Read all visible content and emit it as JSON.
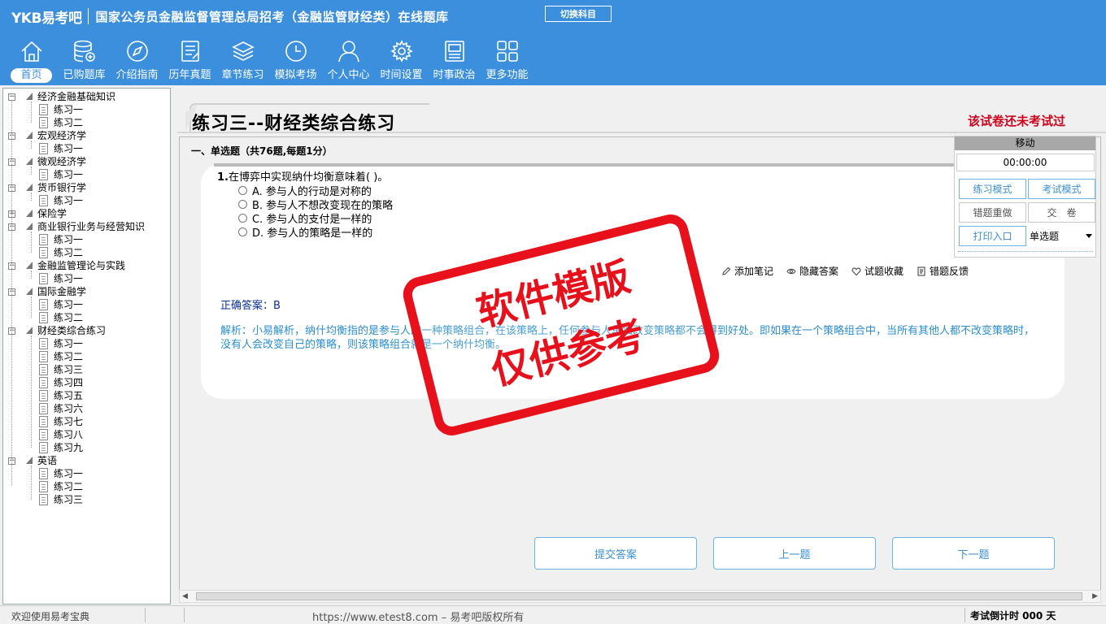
{
  "header": {
    "logo": "YKB易考吧",
    "app_title": "国家公务员金融监督管理总局招考（金融监管财经类）在线题库",
    "switch_subject": "切换科目"
  },
  "nav": [
    {
      "label": "首页",
      "icon": "home-icon"
    },
    {
      "label": "已购题库",
      "icon": "database-icon"
    },
    {
      "label": "介绍指南",
      "icon": "compass-icon"
    },
    {
      "label": "历年真题",
      "icon": "document-icon"
    },
    {
      "label": "章节练习",
      "icon": "layers-icon"
    },
    {
      "label": "模拟考场",
      "icon": "clock-icon"
    },
    {
      "label": "个人中心",
      "icon": "user-icon"
    },
    {
      "label": "时间设置",
      "icon": "gear-icon"
    },
    {
      "label": "时事政治",
      "icon": "news-icon"
    },
    {
      "label": "更多功能",
      "icon": "grid-icon"
    }
  ],
  "tree": [
    {
      "label": "经济金融基础知识",
      "children": [
        "练习一",
        "练习二"
      ]
    },
    {
      "label": "宏观经济学",
      "children": [
        "练习一"
      ]
    },
    {
      "label": "微观经济学",
      "children": [
        "练习一"
      ]
    },
    {
      "label": "货币银行学",
      "children": [
        "练习一"
      ]
    },
    {
      "label": "保险学",
      "children": []
    },
    {
      "label": "商业银行业务与经营知识",
      "children": [
        "练习一",
        "练习二"
      ]
    },
    {
      "label": "金融监管理论与实践",
      "children": [
        "练习一"
      ]
    },
    {
      "label": "国际金融学",
      "children": [
        "练习一",
        "练习二"
      ]
    },
    {
      "label": "财经类综合练习",
      "children": [
        "练习一",
        "练习二",
        "练习三",
        "练习四",
        "练习五",
        "练习六",
        "练习七",
        "练习八",
        "练习九"
      ]
    },
    {
      "label": "英语",
      "children": [
        "练习一",
        "练习二",
        "练习三"
      ]
    }
  ],
  "paper": {
    "title": "练习三--财经类综合练习",
    "status": "该试卷还未考试过",
    "section": "一、单选题（共76题,每题1分）"
  },
  "question": {
    "number": "1.",
    "stem": "在博弈中实现纳什均衡意味着( )。",
    "options": [
      "A. 参与人的行动是对称的",
      "B. 参与人不想改变现在的策略",
      "C. 参与人的支付是一样的",
      "D. 参与人的策略是一样的"
    ],
    "tools": [
      "添加笔记",
      "隐藏答案",
      "试题收藏",
      "错题反馈"
    ],
    "answer": "正确答案：B",
    "analysis": "解析：小易解析，纳什均衡指的是参与人的一种策略组合，在该策略上，任何参与人单独改变策略都不会得到好处。即如果在一个策略组合中，当所有其他人都不改变策略时，没有人会改变自己的策略，则该策略组合就是一个纳什均衡。"
  },
  "footer_buttons": [
    "提交答案",
    "上一题",
    "下一题"
  ],
  "control_panel": {
    "move": "移动",
    "timer": "00:00:00",
    "practice_mode": "练习模式",
    "exam_mode": "考试模式",
    "redo_wrong": "错题重做",
    "submit_paper": "交　卷",
    "print": "打印入口",
    "type_select": "单选题"
  },
  "status": {
    "welcome": "欢迎使用易考宝典",
    "copyright": "https://www.etest8.com – 易考吧版权所有",
    "countdown": "考试倒计时 000 天"
  },
  "watermark": {
    "line1": "软件模版",
    "line2": "仅供参考"
  },
  "colors": {
    "header_blue": "#3b8fdc",
    "accent_red": "#d0021b",
    "link_blue": "#3a8fd4"
  }
}
